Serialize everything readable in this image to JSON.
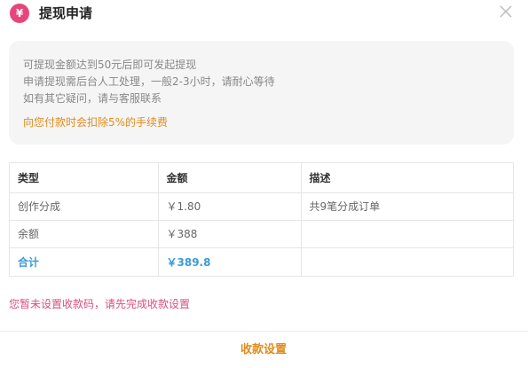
{
  "dialog": {
    "title": "提现申请",
    "icon_glyph": "¥",
    "accent_color": "#e8457a"
  },
  "notice": {
    "lines": [
      "可提现金额达到50元后即可发起提现",
      "申请提现需后台人工处理，一般2-3小时，请耐心等待",
      "如有其它疑问，请与客服联系"
    ],
    "fee_note": "向您付款时会扣除5%的手续费",
    "fee_color": "#e28b1c"
  },
  "table": {
    "headers": [
      "类型",
      "金额",
      "描述"
    ],
    "rows": [
      {
        "type": "创作分成",
        "amount": "￥1.80",
        "desc": "共9笔分成订单"
      },
      {
        "type": "余额",
        "amount": "￥388",
        "desc": ""
      }
    ],
    "total": {
      "type": "合计",
      "amount": "￥389.8",
      "desc": ""
    },
    "total_color": "#3a9ad9"
  },
  "warning": "您暂未设置收款码，请先完成收款设置",
  "footer": {
    "settings_label": "收款设置"
  }
}
